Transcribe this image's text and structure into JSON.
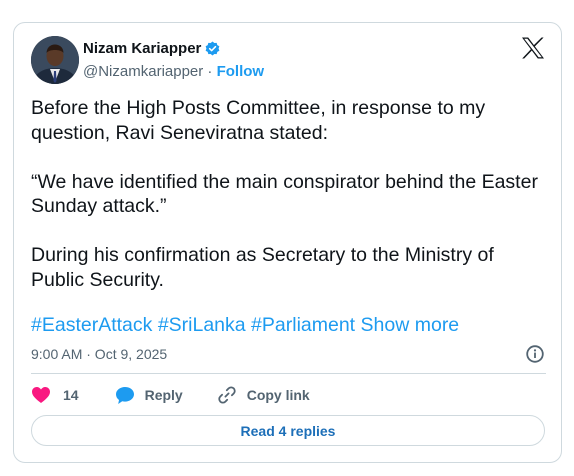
{
  "author": {
    "name": "Nizam Kariapper",
    "handle": "@Nizamkariapper",
    "separator": " · ",
    "follow_label": "Follow"
  },
  "tweet": {
    "text": "Before the High Posts Committee, in response to my question, Ravi Seneviratna stated:\n\n“We have identified the main conspirator behind the Easter Sunday attack.”\n\nDuring his confirmation as Secretary to the Ministry of Public Security.",
    "hashtags": [
      "#EasterAttack",
      "#SriLanka",
      "#Parliament"
    ],
    "show_more_label": "Show more",
    "timestamp": "9:00 AM · Oct 9, 2025"
  },
  "actions": {
    "like_count": "14",
    "reply_label": "Reply",
    "copy_label": "Copy link",
    "read_replies_label": "Read 4 replies"
  },
  "icons": {
    "verified": "verified-badge-icon",
    "platform": "x-logo-icon",
    "info": "info-icon",
    "like": "heart-icon",
    "reply": "speech-bubble-icon",
    "copy": "link-icon"
  },
  "colors": {
    "accent": "#1d9bf0",
    "like": "#f91880",
    "text": "#0f1419",
    "muted": "#536471",
    "border": "#cfd9de"
  }
}
